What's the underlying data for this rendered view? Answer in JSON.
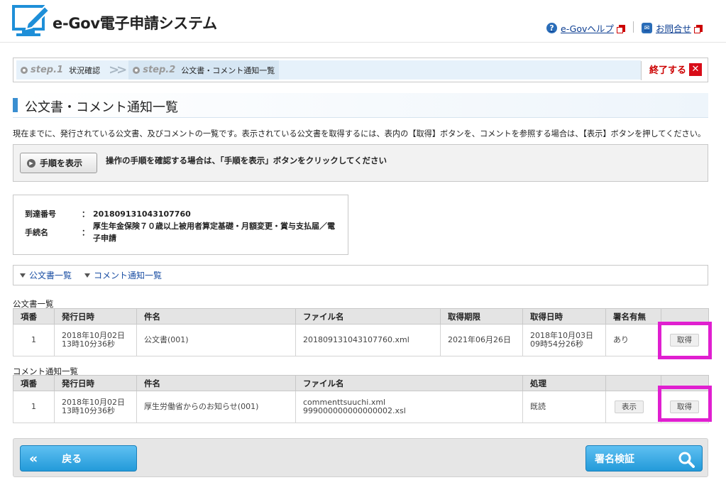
{
  "header": {
    "logo_text": "e-Gov電子申請システム",
    "help_link": "e-Govヘルプ",
    "contact_link": "お問合せ"
  },
  "stepbar": {
    "steps": [
      {
        "name": "step.1",
        "label": "状況確認"
      },
      {
        "name": "step.2",
        "label": "公文書・コメント通知一覧"
      }
    ],
    "end_label": "終了する"
  },
  "page": {
    "title": "公文書・コメント通知一覧",
    "description": "現在までに、発行されている公文書、及びコメントの一覧です。表示されている公文書を取得するには、表内の【取得】ボタンを、コメントを参照する場合は、【表示】ボタンを押してください。"
  },
  "procedure": {
    "button_label": "手順を表示",
    "text": "操作の手順を確認する場合は、「手順を表示」ボタンをクリックしてください"
  },
  "info": {
    "arrival_label": "到達番号",
    "arrival_value": "201809131043107760",
    "proc_label": "手続名",
    "proc_value": "厚生年金保険７０歳以上被用者算定基礎・月額変更・賞与支払届／電子申請",
    "colon": "："
  },
  "jump_links": {
    "docs": "公文書一覧",
    "comments": "コメント通知一覧"
  },
  "docs_table": {
    "caption": "公文書一覧",
    "headers": [
      "項番",
      "発行日時",
      "件名",
      "ファイル名",
      "取得期限",
      "取得日時",
      "署名有無",
      ""
    ],
    "row": {
      "no": "1",
      "issued_date": "2018年10月02日",
      "issued_time": "13時10分36秒",
      "subject": "公文書(001)",
      "file": "201809131043107760.xml",
      "deadline": "2021年06月26日",
      "acquired_date": "2018年10月03日",
      "acquired_time": "09時54分26秒",
      "signed": "あり",
      "button": "取得"
    }
  },
  "comments_table": {
    "caption": "コメント通知一覧",
    "headers": [
      "項番",
      "発行日時",
      "件名",
      "ファイル名",
      "処理",
      "",
      ""
    ],
    "row": {
      "no": "1",
      "issued_date": "2018年10月02日",
      "issued_time": "13時10分36秒",
      "subject": "厚生労働省からのお知らせ(001)",
      "file1": "commenttsuuchi.xml",
      "file2": "999000000000000002.xsl",
      "status": "既読",
      "view_button": "表示",
      "get_button": "取得"
    }
  },
  "footer": {
    "back_label": "戻る",
    "verify_label": "署名検証"
  },
  "colors": {
    "accent": "#3a8fd1",
    "highlight": "#e01fd0",
    "button_blue": "#239ad9",
    "end_red": "#d80c18"
  }
}
